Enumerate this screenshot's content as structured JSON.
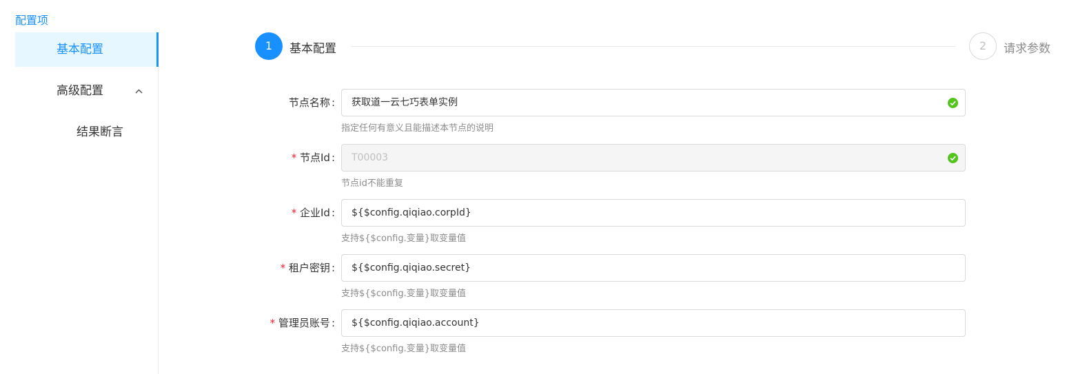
{
  "sidebar": {
    "title": "配置项",
    "items": [
      {
        "label": "基本配置"
      },
      {
        "label": "高级配置"
      },
      {
        "label": "结果断言"
      }
    ]
  },
  "steps": [
    {
      "number": "1",
      "title": "基本配置"
    },
    {
      "number": "2",
      "title": "请求参数"
    }
  ],
  "form": {
    "fields": [
      {
        "label": "节点名称",
        "colon": ":",
        "value": "获取道一云七巧表单实例",
        "help": "指定任何有意义且能描述本节点的说明"
      },
      {
        "required_mark": "*",
        "label": "节点Id",
        "colon": ":",
        "value": "T00003",
        "help": "节点id不能重复"
      },
      {
        "required_mark": "*",
        "label": "企业Id",
        "colon": ":",
        "value": "${$config.qiqiao.corpId}",
        "help": "支持${$config.变量}取变量值"
      },
      {
        "required_mark": "*",
        "label": "租户密钥",
        "colon": ":",
        "value": "${$config.qiqiao.secret}",
        "help": "支持${$config.变量}取变量值"
      },
      {
        "required_mark": "*",
        "label": "管理员账号",
        "colon": ":",
        "value": "${$config.qiqiao.account}",
        "help": "支持${$config.变量}取变量值"
      }
    ]
  },
  "colors": {
    "primary": "#1890ff",
    "success": "#52c41a",
    "required": "#f5222d"
  }
}
